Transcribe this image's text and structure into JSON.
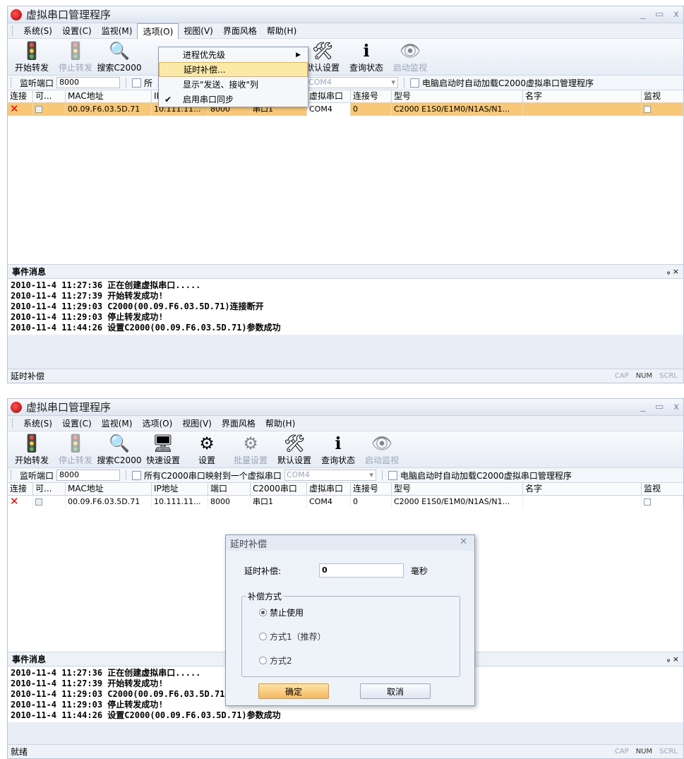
{
  "window": {
    "title": "虚拟串口管理程序",
    "controls": [
      "_",
      "▭",
      "x"
    ]
  },
  "menu": [
    "系统(S)",
    "设置(C)",
    "监视(M)",
    "选项(O)",
    "视图(V)",
    "界面风格",
    "帮助(H)"
  ],
  "toolbar": [
    {
      "label": "开始转发",
      "icon": "traffic-light-icon",
      "enabled": true
    },
    {
      "label": "停止转发",
      "icon": "traffic-light-icon",
      "enabled": false
    },
    {
      "label": "搜索C2000",
      "icon": "magnifier-icon",
      "enabled": true
    },
    {
      "label": "快速设置",
      "icon": "quick-setup-icon",
      "enabled": true
    },
    {
      "label": "设置",
      "icon": "gears-icon",
      "enabled": true
    },
    {
      "label": "批量设置",
      "icon": "batch-gears-icon",
      "enabled": false
    },
    {
      "label": "默认设置",
      "icon": "tools-icon",
      "enabled": true
    },
    {
      "label": "查询状态",
      "icon": "info-icon",
      "enabled": true
    },
    {
      "label": "启动监视",
      "icon": "monitor-eye-icon",
      "enabled": false
    }
  ],
  "optbar": {
    "port_label": "监听端口",
    "port_value": "8000",
    "map_all_label": "所有C2000串口映射到一个虚拟串口",
    "map_all_short": "所",
    "com_value": "COM4",
    "autoload_label": "电脑启动时自动加载C2000虚拟串口管理程序"
  },
  "table": {
    "columns": [
      "连接",
      "可...",
      "MAC地址",
      "IP地址",
      "端口",
      "C2000串口",
      "虚拟串口",
      "连接号",
      "型号",
      "名字",
      "监视"
    ],
    "row": [
      "00.09.F6.03.5D.71",
      "10.111.11...",
      "8000",
      "串口1",
      "COM4",
      "0",
      "C2000 E1S0/E1M0/N1AS/N1...",
      ""
    ]
  },
  "events": {
    "title": "事件消息",
    "pin": "ᵩ ×",
    "lines": [
      "2010-11-4 11:27:36  正在创建虚拟串口.....",
      "2010-11-4 11:27:39  开始转发成功!",
      "2010-11-4 11:29:03  C2000(00.09.F6.03.5D.71)连接断开",
      "2010-11-4 11:29:03  停止转发成功!",
      "2010-11-4 11:44:26  设置C2000(00.09.F6.03.5D.71)参数成功"
    ]
  },
  "status": {
    "text1": "延时补偿",
    "text2": "就绪",
    "indicators": [
      "CAP",
      "NUM",
      "SCRL"
    ]
  },
  "dropdown": {
    "items": [
      "进程优先级",
      "延时补偿...",
      "显示\"发送、接收\"列",
      "启用串口同步"
    ]
  },
  "dialog": {
    "title": "延时补偿",
    "delay_label": "延时补偿:",
    "delay_value": "0",
    "unit": "毫秒",
    "group_label": "补偿方式",
    "options": [
      "禁止使用",
      "方式1（推荐）",
      "方式2"
    ],
    "ok": "确定",
    "cancel": "取消"
  }
}
